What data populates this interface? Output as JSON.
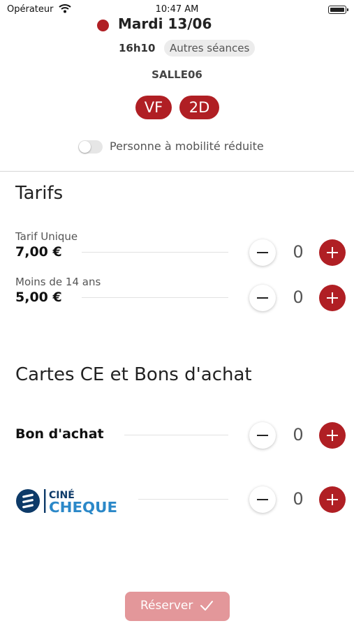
{
  "status_bar": {
    "carrier": "Opérateur",
    "time": "10:47 AM"
  },
  "session": {
    "date": "Mardi 13/06",
    "time": "16h10",
    "other_sessions": "Autres séances",
    "room": "SALLE06",
    "tags": [
      "VF",
      "2D"
    ],
    "reduced_mobility_label": "Personne à mobilité réduite",
    "reduced_mobility_on": false
  },
  "tariffs": {
    "title": "Tarifs",
    "items": [
      {
        "name": "Tarif Unique",
        "price": "7,00 €",
        "quantity": "0"
      },
      {
        "name": "Moins de 14 ans",
        "price": "5,00 €",
        "quantity": "0"
      }
    ]
  },
  "vouchers": {
    "title": "Cartes CE et Bons d'achat",
    "items": [
      {
        "name": "Bon d'achat",
        "quantity": "0"
      },
      {
        "name": "CINÉCHÈQUE",
        "logo_top": "CINÉ",
        "logo_bottom": "CHEQUE",
        "quantity": "0"
      }
    ]
  },
  "footer": {
    "reserve_label": "Réserver"
  },
  "colors": {
    "accent": "#b01f24",
    "reserve_disabled": "#e3979a",
    "logo_blue": "#0d3a68"
  },
  "icons": {
    "wifi": "wifi-icon",
    "battery": "battery-icon",
    "minus": "minus-icon",
    "plus": "plus-icon",
    "check": "check-icon"
  }
}
